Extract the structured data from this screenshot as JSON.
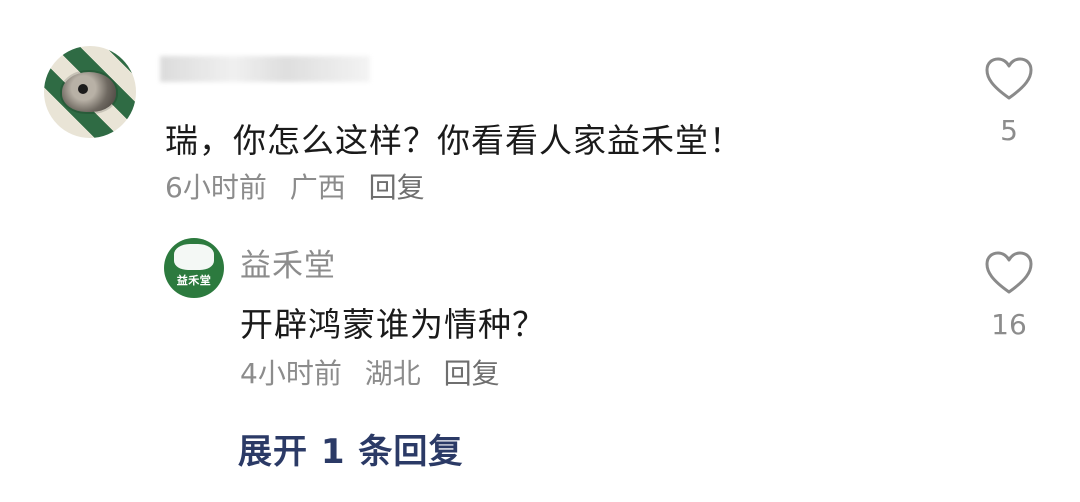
{
  "comment": {
    "avatar_icon": "user-avatar-icon",
    "username_blurred": true,
    "text": "瑞，你怎么这样？你看看人家益禾堂！",
    "time": "6小时前",
    "location": "广西",
    "reply_label": "回复",
    "likes": "5"
  },
  "reply": {
    "author": "益禾堂",
    "avatar_icon": "brand-avatar-icon",
    "avatar_text": "益禾堂",
    "text": "开辟鸿蒙谁为情种？",
    "time": "4小时前",
    "location": "湖北",
    "reply_label": "回复",
    "likes": "16"
  },
  "expand_replies_label": "展开 1 条回复",
  "colors": {
    "text_primary": "#1a1a1a",
    "text_secondary": "#8c8c8c",
    "expand_link": "#2b3a66",
    "heart_outline": "#8a8a8a"
  }
}
